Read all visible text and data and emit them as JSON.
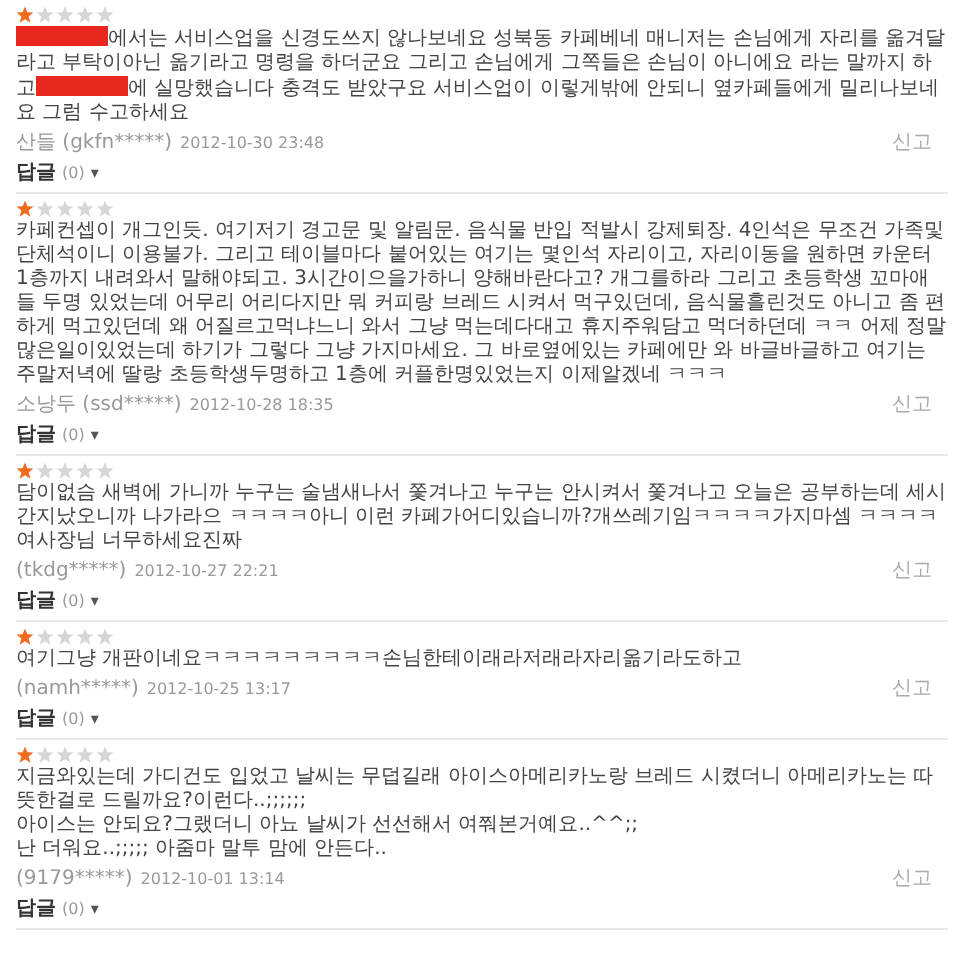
{
  "reviews": [
    {
      "stars": 1,
      "text": [
        {
          "kind": "redaction"
        },
        {
          "kind": "text",
          "value": "에서는 서비스업을 신경도쓰지 않나보네요 성북동 카페베네 매니저는 손님에게 자리를 옮겨달라고 부탁이아닌 옮기라고 명령을 하더군요 그리고 손님에게 그쪽들은 손님이 아니에요 라는 말까지 하고"
        },
        {
          "kind": "redaction"
        },
        {
          "kind": "text",
          "value": "에 실망했습니다 충격도 받았구요 서비스업이 이렇게밖에 안되니 옆카페들에게 밀리나보네요 그럼 수고하세요"
        }
      ],
      "author": "산들 (gkfn*****)",
      "date": "2012-10-30 23:48",
      "report": "신고",
      "reply": "답글",
      "reply_count": "(0)",
      "caret": "▾"
    },
    {
      "stars": 1,
      "text": [
        {
          "kind": "text",
          "value": "카페컨셉이 개그인듯. 여기저기 경고문 및 알림문. 음식물 반입 적발시 강제퇴장. 4인석은 무조건 가족및 단체석이니 이용불가. 그리고 테이블마다 붙어있는 여기는 몇인석 자리이고, 자리이동을 원하면 카운터 1층까지 내려와서 말해야되고. 3시간이으을가하니 양해바란다고? 개그를하라 그리고 초등학생 꼬마애들 두명 있었는데 어무리 어리다지만 뭐 커피랑 브레드 시켜서 먹구있던데, 음식물흘린것도 아니고 좀 편하게 먹고있던데 왜 어질르고먹냐느니 와서 그냥 먹는데다대고 휴지주워담고 먹더하던데 ㅋㅋ 어제 정말 많은일이있었는데 하기가 그렇다 그냥 가지마세요. 그 바로옆에있는 카페에만 와 바글바글하고 여기는 주말저녁에 딸랑 초등학생두명하고 1층에 커플한명있었는지 이제알겠네 ㅋㅋㅋ"
        }
      ],
      "author": "소낭두 (ssd*****)",
      "date": "2012-10-28 18:35",
      "report": "신고",
      "reply": "답글",
      "reply_count": "(0)",
      "caret": "▾"
    },
    {
      "stars": 1,
      "text": [
        {
          "kind": "text",
          "value": "담이없슴 새벽에 가니까 누구는 술냄새나서 쫓겨나고 누구는 안시켜서 쫓겨나고 오늘은 공부하는데 세시간지났오니까 나가라으 ㅋㅋㅋㅋ아니 이런 카페가어디있습니까?개쓰레기임ㅋㅋㅋㅋ가지마셈 ㅋㅋㅋㅋ여사장님 너무하세요진짜"
        }
      ],
      "author": "(tkdg*****)",
      "date": "2012-10-27 22:21",
      "report": "신고",
      "reply": "답글",
      "reply_count": "(0)",
      "caret": "▾"
    },
    {
      "stars": 1,
      "text": [
        {
          "kind": "text",
          "value": "여기그냥 개판이네요ㅋㅋㅋㅋㅋㅋㅋㅋㅋ손님한테이래라저래라자리옮기라도하고"
        }
      ],
      "author": "(namh*****)",
      "date": "2012-10-25 13:17",
      "report": "신고",
      "reply": "답글",
      "reply_count": "(0)",
      "caret": "▾"
    },
    {
      "stars": 1,
      "text": [
        {
          "kind": "text",
          "value": "지금와있는데 가디건도 입었고 날씨는 무덥길래 아이스아메리카노랑 브레드 시켰더니 아메리카노는 따뜻한걸로 드릴까요?이런다..;;;;;;\n아이스는 안되요?그랬더니 아뇨 날씨가 선선해서 여쭤본거예요..^^;;\n난 더워요..;;;;; 아줌마 말투 맘에 안든다.."
        }
      ],
      "author": "(9179*****)",
      "date": "2012-10-01 13:14",
      "report": "신고",
      "reply": "답글",
      "reply_count": "(0)",
      "caret": "▾"
    }
  ]
}
